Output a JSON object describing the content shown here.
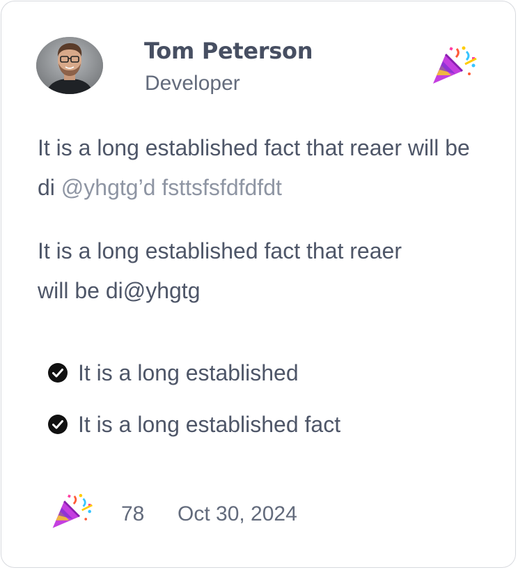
{
  "author": {
    "name": "Tom Peterson",
    "role": "Developer",
    "avatar_icon": "avatar-photo"
  },
  "header_icon": "party-popper-icon",
  "post": {
    "paragraph1_text": "It is a long established fact that reaer will be di ",
    "paragraph1_mention": "@yhgtg’d fsttsfsfdfdfdt",
    "paragraph2_text": "It is a long established fact that reaer will be di@yhgtg"
  },
  "checklist": [
    {
      "icon": "check-circle-icon",
      "text": "It is a long established"
    },
    {
      "icon": "check-circle-icon",
      "text": "It is a long established fact"
    }
  ],
  "footer": {
    "reaction_icon": "party-popper-icon",
    "reaction_count": "78",
    "date": "Oct 30, 2024"
  },
  "colors": {
    "text_primary": "#474f62",
    "text_body": "#4e5668",
    "mention": "#8e95a3",
    "border": "#d7d9de",
    "check": "#111111"
  }
}
